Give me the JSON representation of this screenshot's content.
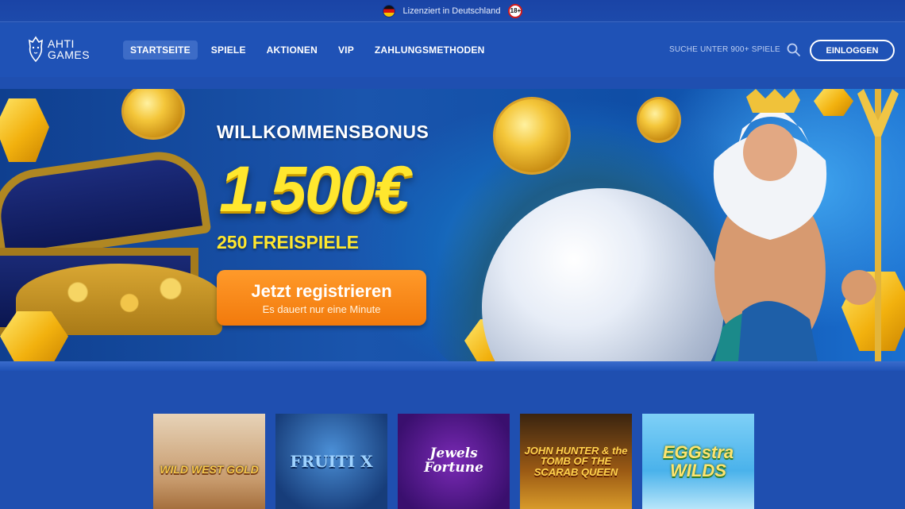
{
  "topbar": {
    "license_text": "Lizenziert in Deutschland",
    "age_badge": "18+",
    "flag_icon": "germany-flag-icon"
  },
  "header": {
    "logo_line1": "AHTI",
    "logo_line2": "GAMES",
    "nav": [
      {
        "label": "STARTSEITE",
        "active": true
      },
      {
        "label": "SPIELE",
        "active": false
      },
      {
        "label": "AKTIONEN",
        "active": false
      },
      {
        "label": "VIP",
        "active": false
      },
      {
        "label": "ZAHLUNGSMETHODEN",
        "active": false
      }
    ],
    "search_label": "SUCHE UNTER 900+ SPIELE",
    "search_icon": "search-icon",
    "login_label": "EINLOGGEN"
  },
  "hero": {
    "title": "WILLKOMMENSBONUS",
    "amount": "1.500€",
    "spins": "250 FREISPIELE",
    "cta_label": "Jetzt registrieren",
    "cta_sub": "Es dauert nur eine Minute"
  },
  "games": [
    {
      "title": "WILD WEST GOLD"
    },
    {
      "title": "FRUITI X"
    },
    {
      "title": "Jewels Fortune"
    },
    {
      "title": "JOHN HUNTER & the TOMB OF THE SCARAB QUEEN"
    },
    {
      "title": "EGGstra WILDS"
    }
  ],
  "colors": {
    "brand_blue": "#1f52b6",
    "accent_yellow": "#ffe72e",
    "cta_orange": "#f27a0c"
  }
}
